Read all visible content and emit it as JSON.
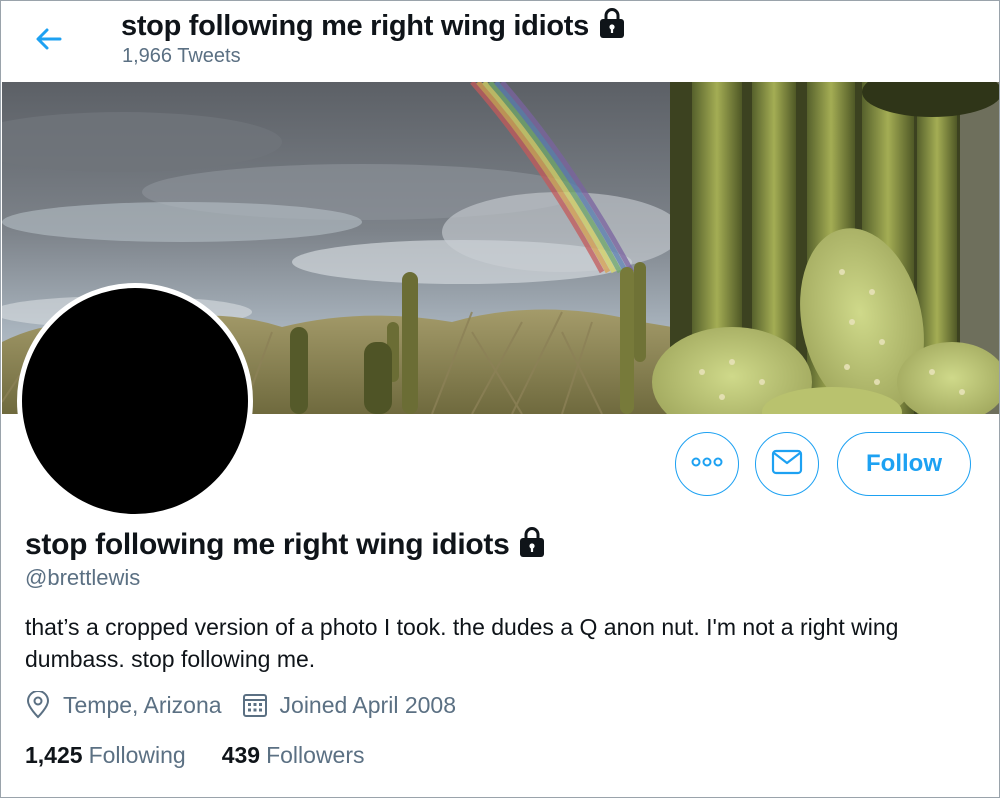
{
  "header": {
    "title": "stop following me right wing idiots",
    "tweet_count": "1,966 Tweets",
    "back_icon": "back-arrow-icon",
    "lock_icon": "lock-icon"
  },
  "profile": {
    "name": "stop following me right wing idiots",
    "handle": "@brettlewis",
    "bio": "that’s a cropped version of a photo I took. the dudes a Q anon nut. I'm not a right wing dumbass. stop following me.",
    "location": "Tempe, Arizona",
    "joined": "Joined April 2008",
    "following_count": "1,425",
    "following_label": "Following",
    "followers_count": "439",
    "followers_label": "Followers"
  },
  "actions": {
    "more_icon": "more-options-icon",
    "message_icon": "envelope-icon",
    "follow_label": "Follow"
  },
  "colors": {
    "accent": "#1da1f2",
    "secondary_text": "#5b7083",
    "primary_text": "#0f1419"
  }
}
